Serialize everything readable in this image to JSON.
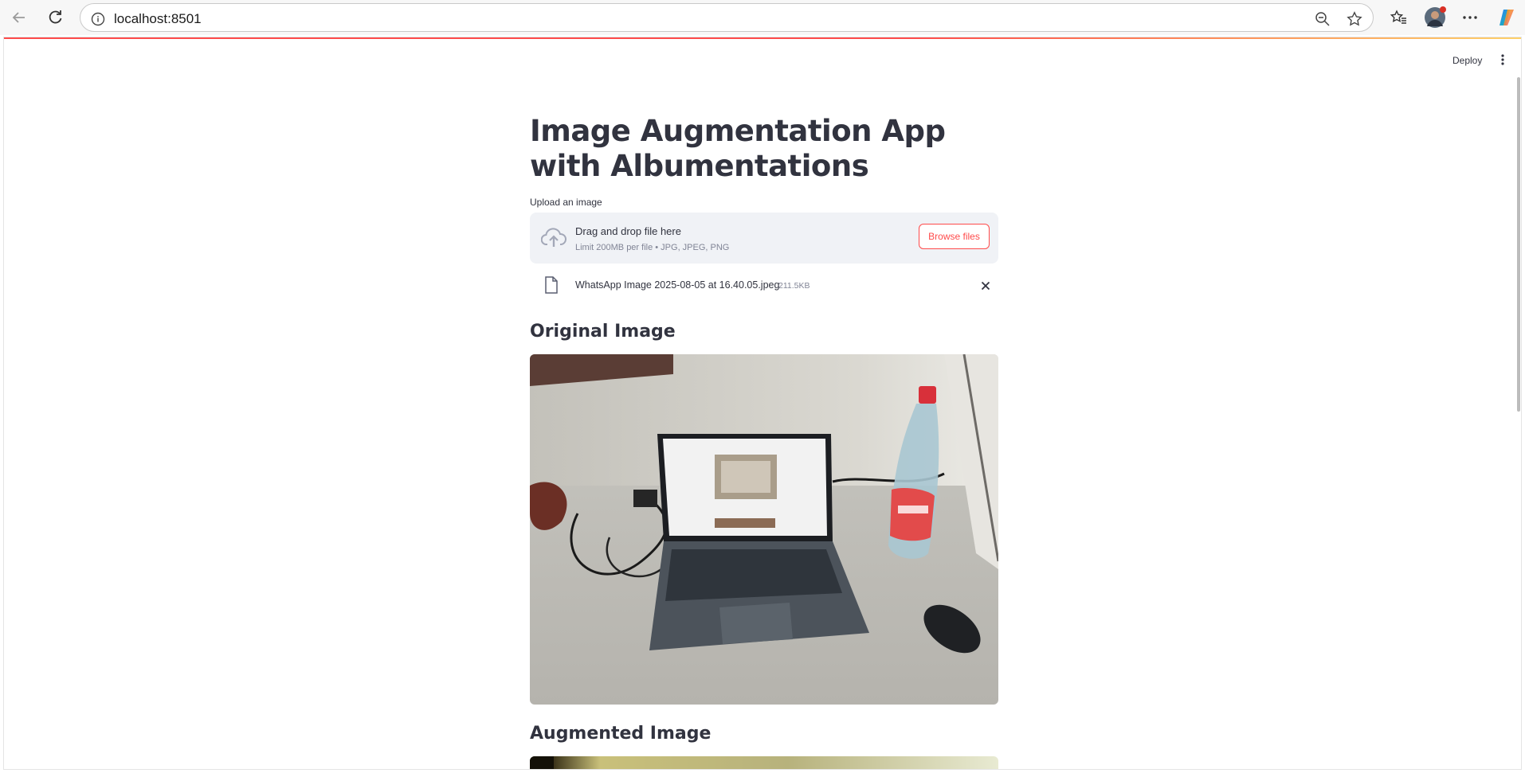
{
  "browser": {
    "url": "localhost:8501"
  },
  "app": {
    "deploy_label": "Deploy",
    "title": "Image Augmentation App with Albumentations",
    "upload_label": "Upload an image",
    "dropzone": {
      "main_text": "Drag and drop file here",
      "sub_text": "Limit 200MB per file • JPG, JPEG, PNG",
      "browse_label": "Browse files"
    },
    "uploaded_file": {
      "name": "WhatsApp Image 2025-08-05 at 16.40.05.jpeg",
      "size": "211.5KB"
    },
    "sections": {
      "original": "Original Image",
      "augmented": "Augmented Image"
    }
  },
  "colors": {
    "accent": "#ff4b4b",
    "text": "#31333f",
    "muted": "#808495",
    "dropzone_bg": "#f0f2f6"
  },
  "icons": [
    "back-arrow-icon",
    "refresh-icon",
    "info-icon",
    "zoom-out-icon",
    "star-icon",
    "favorites-icon",
    "avatar",
    "more-icon",
    "copilot-icon",
    "kebab-menu-icon",
    "cloud-upload-icon",
    "file-icon",
    "close-icon"
  ]
}
